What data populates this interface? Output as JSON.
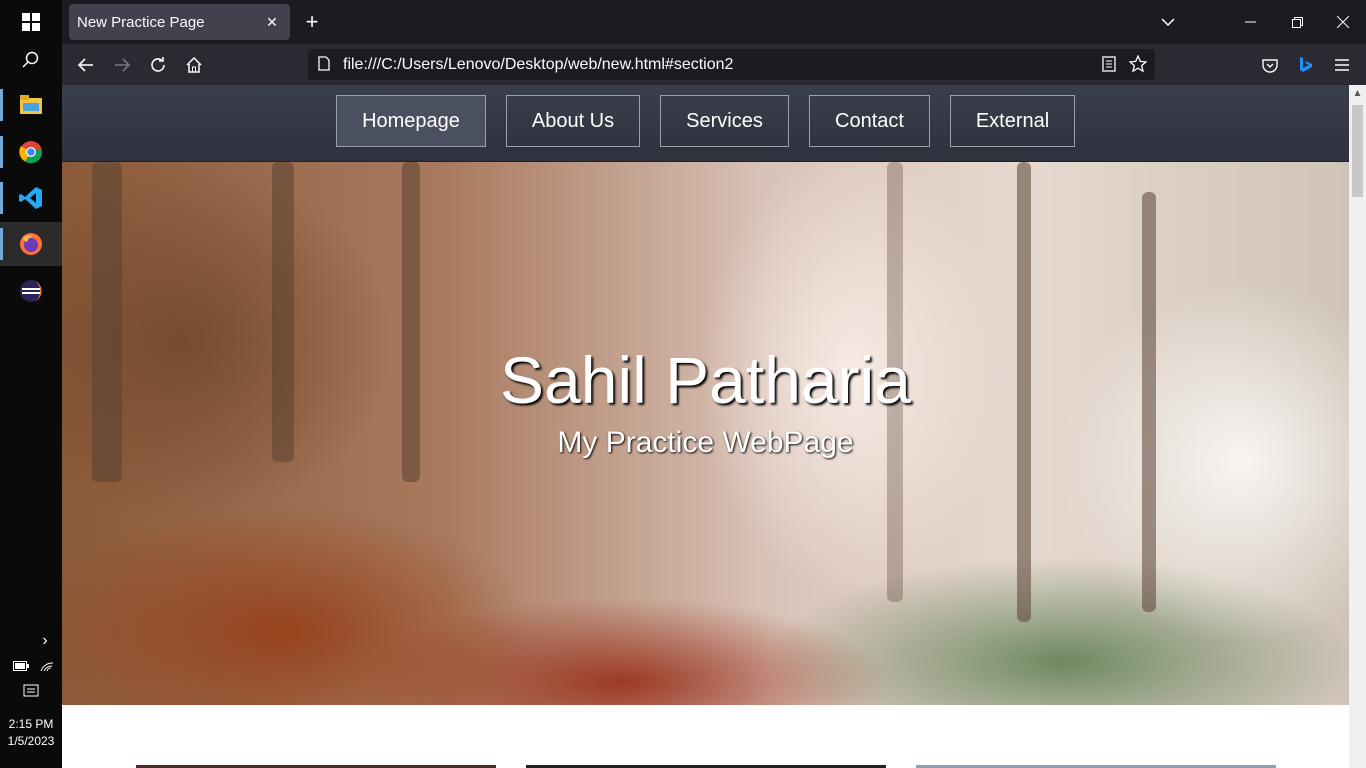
{
  "taskbar": {
    "icons": [
      "windows-start-icon",
      "search-icon",
      "file-explorer-icon",
      "chrome-icon",
      "vscode-icon",
      "firefox-icon",
      "eclipse-icon"
    ],
    "time": "2:15 PM",
    "date": "1/5/2023"
  },
  "browser": {
    "tab_title": "New Practice Page",
    "url": "file:///C:/Users/Lenovo/Desktop/web/new.html#section2"
  },
  "site": {
    "nav": [
      "Homepage",
      "About Us",
      "Services",
      "Contact",
      "External"
    ],
    "active_nav": "Homepage",
    "hero_title": "Sahil Patharia",
    "hero_subtitle": "My Practice WebPage"
  },
  "colors": {
    "nav_bg": "#343945",
    "browser_toolbar": "#2b2a33",
    "tab_active": "#42414d"
  }
}
